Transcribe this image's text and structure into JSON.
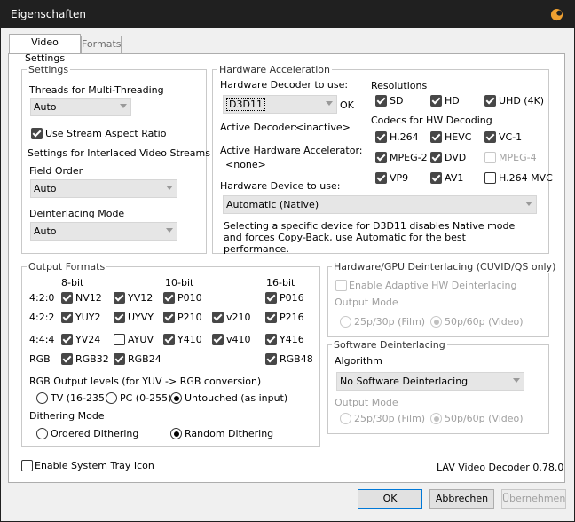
{
  "window": {
    "title": "Eigenschaften"
  },
  "tabs": [
    {
      "label": "Video Settings"
    },
    {
      "label": "Formats"
    }
  ],
  "settings": {
    "title": "Settings",
    "threads_label": "Threads for Multi-Threading",
    "threads_value": "Auto",
    "stream_aspect_label": "Use Stream Aspect Ratio",
    "interlaced_label": "Settings for Interlaced Video Streams",
    "field_order_label": "Field Order",
    "field_order_value": "Auto",
    "deint_mode_label": "Deinterlacing Mode",
    "deint_mode_value": "Auto"
  },
  "hwaccel": {
    "title": "Hardware Acceleration",
    "decoder_label": "Hardware Decoder to use:",
    "decoder_value": "D3D11",
    "decoder_status": "OK",
    "active_decoder_label": "Active Decoder:",
    "active_decoder_value": "<inactive>",
    "active_accel_label": "Active Hardware Accelerator:",
    "active_accel_value": "<none>",
    "device_label": "Hardware Device to use:",
    "device_value": "Automatic (Native)",
    "note": "Selecting a specific device for D3D11 disables Native mode and forces Copy-Back, use Automatic for the best performance.",
    "resolutions_label": "Resolutions",
    "res_sd": "SD",
    "res_hd": "HD",
    "res_uhd": "UHD (4K)",
    "codecs_label": "Codecs for HW Decoding",
    "c_h264": "H.264",
    "c_hevc": "HEVC",
    "c_vc1": "VC-1",
    "c_mpeg2": "MPEG-2",
    "c_dvd": "DVD",
    "c_mpeg4": "MPEG-4",
    "c_vp9": "VP9",
    "c_av1": "AV1",
    "c_h264mvc": "H.264 MVC"
  },
  "output": {
    "title": "Output Formats",
    "h_8bit": "8-bit",
    "h_10bit": "10-bit",
    "h_16bit": "16-bit",
    "r_420": "4:2:0",
    "r_422": "4:2:2",
    "r_444": "4:4:4",
    "r_rgb": "RGB",
    "nv12": "NV12",
    "yv12": "YV12",
    "p010": "P010",
    "p016": "P016",
    "yuy2": "YUY2",
    "uyvy": "UYVY",
    "p210": "P210",
    "v210": "v210",
    "p216": "P216",
    "yv24": "YV24",
    "ayuv": "AYUV",
    "y410": "Y410",
    "v410": "v410",
    "y416": "Y416",
    "rgb32": "RGB32",
    "rgb24": "RGB24",
    "rgb48": "RGB48",
    "levels_label": "RGB Output levels (for YUV -> RGB conversion)",
    "tv": "TV (16-235)",
    "pc": "PC (0-255)",
    "untouched": "Untouched (as input)",
    "dither_label": "Dithering Mode",
    "ordered": "Ordered Dithering",
    "random": "Random Dithering"
  },
  "hwdeint": {
    "title": "Hardware/GPU Deinterlacing (CUVID/QS only)",
    "enable_label": "Enable Adaptive HW Deinterlacing",
    "output_mode": "Output Mode",
    "film": "25p/30p (Film)",
    "video": "50p/60p (Video)"
  },
  "swdeint": {
    "title": "Software Deinterlacing",
    "algorithm_label": "Algorithm",
    "algorithm_value": "No Software Deinterlacing",
    "output_mode": "Output Mode",
    "film": "25p/30p (Film)",
    "video": "50p/60p (Video)"
  },
  "footer": {
    "tray_label": "Enable System Tray Icon",
    "version": "LAV Video Decoder 0.78.0"
  },
  "buttons": {
    "ok": "OK",
    "cancel": "Abbrechen",
    "apply": "Übernehmen"
  },
  "colors": {
    "titlebar": "#202020",
    "panel": "#ffffff",
    "check": "#474747",
    "accent": "#0078d7"
  }
}
